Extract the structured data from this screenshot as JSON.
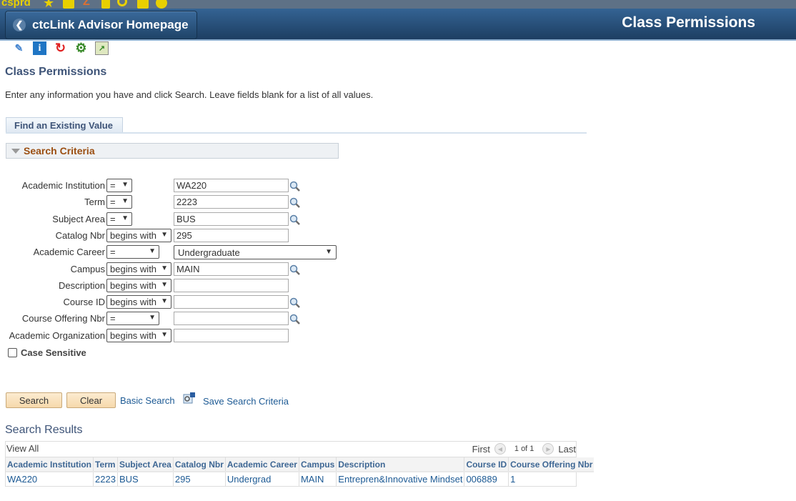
{
  "topbar": {
    "environment": "csprd",
    "icons": [
      "star-icon",
      "folder-icon",
      "edit-icon",
      "page-icon",
      "search-icon",
      "workspace-icon",
      "help-icon"
    ]
  },
  "banner": {
    "home_button": "ctcLink Advisor Homepage",
    "page_title": "Class Permissions"
  },
  "toolbar_icons": [
    "eraser-icon",
    "info-icon",
    "refresh-icon",
    "gear-icon",
    "chart-icon"
  ],
  "page": {
    "title": "Class Permissions",
    "instructions": "Enter any information you have and click Search. Leave fields blank for a list of all values.",
    "tab": "Find an Existing Value",
    "criteria_header": "Search Criteria"
  },
  "criteria": [
    {
      "label": "Academic Institution",
      "operator": "=",
      "value": "WA220",
      "lookup": true
    },
    {
      "label": "Term",
      "operator": "=",
      "value": "2223",
      "lookup": true
    },
    {
      "label": "Subject Area",
      "operator": "=",
      "value": "BUS",
      "lookup": true
    },
    {
      "label": "Catalog Nbr",
      "operator": "begins with",
      "value": "295",
      "lookup": false
    },
    {
      "label": "Academic Career",
      "operator": "=",
      "value": "Undergraduate",
      "lookup": false
    },
    {
      "label": "Campus",
      "operator": "begins with",
      "value": "MAIN",
      "lookup": true
    },
    {
      "label": "Description",
      "operator": "begins with",
      "value": "",
      "lookup": false
    },
    {
      "label": "Course ID",
      "operator": "begins with",
      "value": "",
      "lookup": true
    },
    {
      "label": "Course Offering Nbr",
      "operator": "=",
      "value": "",
      "lookup": true
    },
    {
      "label": "Academic Organization",
      "operator": "begins with",
      "value": "",
      "lookup": false
    }
  ],
  "case_sensitive": {
    "label": "Case Sensitive",
    "checked": false
  },
  "actions": {
    "search": "Search",
    "clear": "Clear",
    "basic_search": "Basic Search",
    "save_criteria": "Save Search Criteria"
  },
  "results": {
    "title": "Search Results",
    "view_all": "View All",
    "first": "First",
    "page_info": "1 of 1",
    "last": "Last",
    "columns": [
      "Academic Institution",
      "Term",
      "Subject Area",
      "Catalog Nbr",
      "Academic Career",
      "Campus",
      "Description",
      "Course ID",
      "Course Offering Nbr"
    ],
    "rows": [
      [
        "WA220",
        "2223",
        "BUS",
        "295",
        "Undergrad",
        "MAIN",
        "Entrepren&Innovative Mindset",
        "006889",
        "1"
      ]
    ]
  }
}
